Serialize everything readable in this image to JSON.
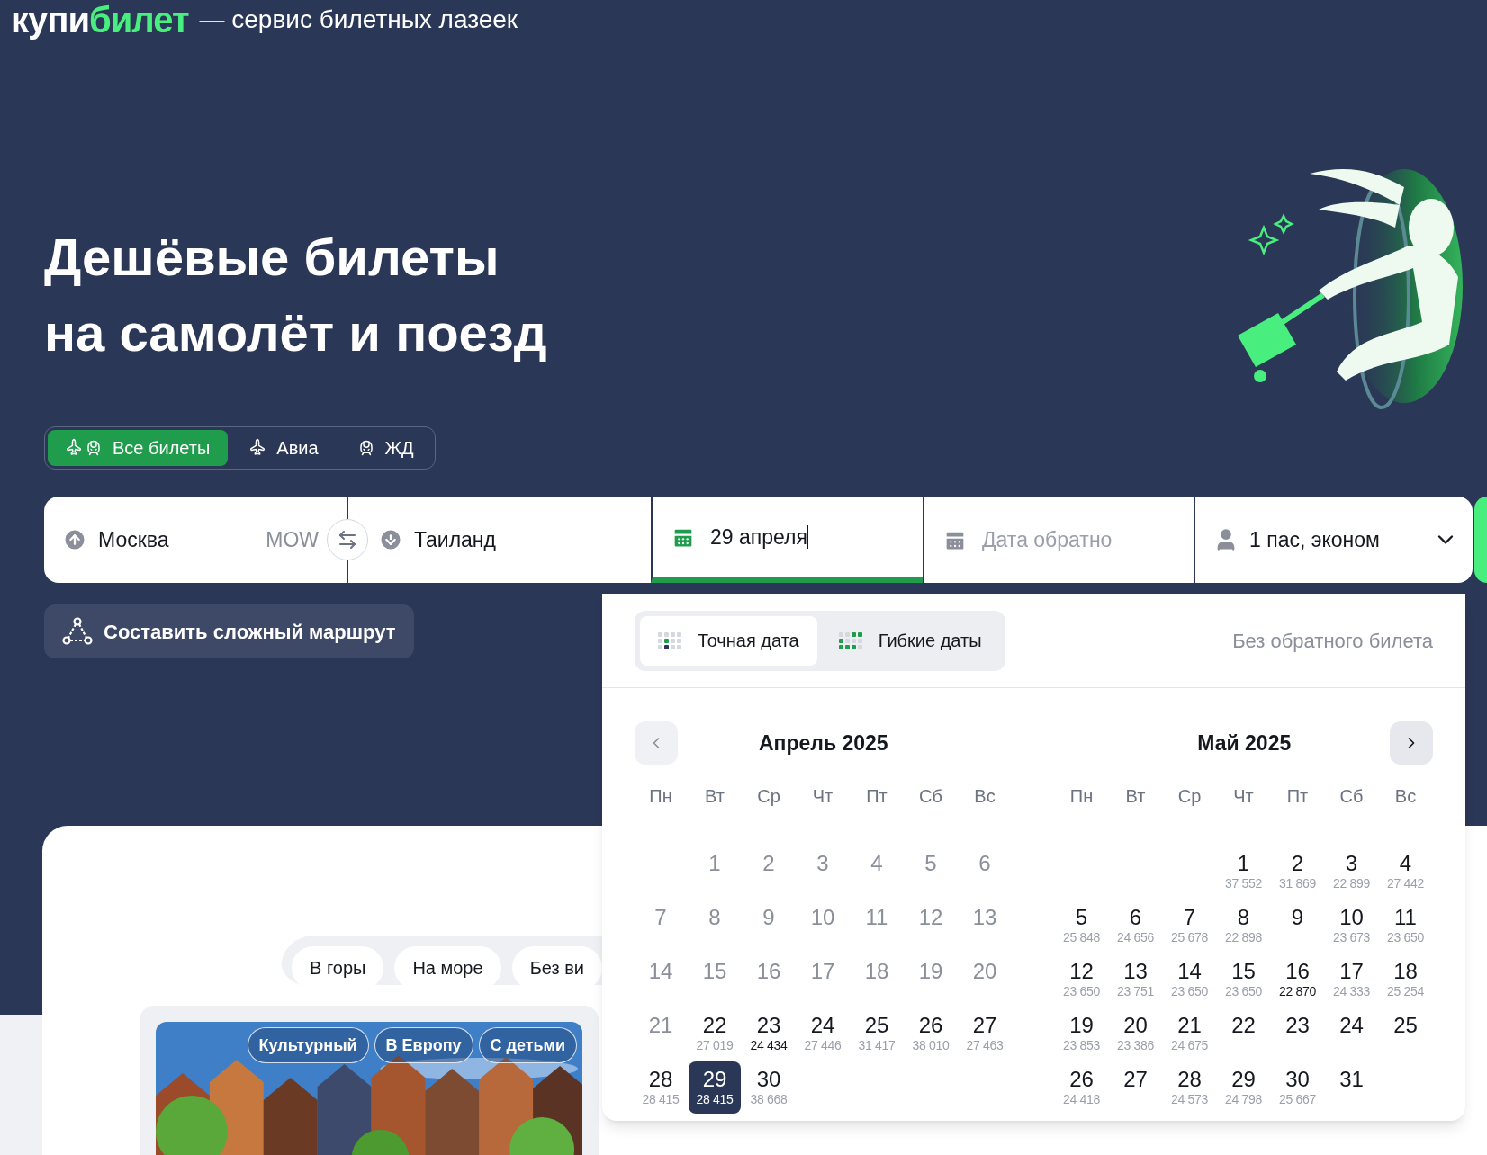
{
  "logo": {
    "first": "купи",
    "second": "билет"
  },
  "tagline": "— сервис билетных лазеек",
  "headline": [
    "Дешёвые билеты",
    "на самолёт и поезд"
  ],
  "transport_tabs": [
    {
      "label": "Все билеты",
      "selected": true
    },
    {
      "label": "Авиа",
      "selected": false
    },
    {
      "label": "ЖД",
      "selected": false
    }
  ],
  "search": {
    "from": {
      "value": "Москва",
      "code": "MOW"
    },
    "to": {
      "value": "Таиланд"
    },
    "depart": {
      "value": "29 апреля",
      "focused": true
    },
    "return": {
      "placeholder": "Дата обратно"
    },
    "passengers": {
      "value": "1 пас, эконом"
    }
  },
  "route_button": "Составить сложный маршрут",
  "date_picker": {
    "modes": [
      {
        "label": "Точная дата",
        "selected": true
      },
      {
        "label": "Гибкие даты",
        "selected": false
      }
    ],
    "no_return": "Без обратного билета",
    "months": [
      {
        "title": "Апрель 2025",
        "weekdays": [
          "Пн",
          "Вт",
          "Ср",
          "Чт",
          "Пт",
          "Сб",
          "Вс"
        ],
        "days": [
          {
            "kind": "blank"
          },
          {
            "kind": "day",
            "day": "1",
            "available": false,
            "selected": false
          },
          {
            "kind": "day",
            "day": "2",
            "available": false,
            "selected": false
          },
          {
            "kind": "day",
            "day": "3",
            "available": false,
            "selected": false
          },
          {
            "kind": "day",
            "day": "4",
            "available": false,
            "selected": false
          },
          {
            "kind": "day",
            "day": "5",
            "available": false,
            "selected": false
          },
          {
            "kind": "day",
            "day": "6",
            "available": false,
            "selected": false
          },
          {
            "kind": "day",
            "day": "7",
            "available": false,
            "selected": false
          },
          {
            "kind": "day",
            "day": "8",
            "available": false,
            "selected": false
          },
          {
            "kind": "day",
            "day": "9",
            "available": false,
            "selected": false
          },
          {
            "kind": "day",
            "day": "10",
            "available": false,
            "selected": false
          },
          {
            "kind": "day",
            "day": "11",
            "available": false,
            "selected": false
          },
          {
            "kind": "day",
            "day": "12",
            "available": false,
            "selected": false
          },
          {
            "kind": "day",
            "day": "13",
            "available": false,
            "selected": false
          },
          {
            "kind": "day",
            "day": "14",
            "available": false,
            "selected": false
          },
          {
            "kind": "day",
            "day": "15",
            "available": false,
            "selected": false
          },
          {
            "kind": "day",
            "day": "16",
            "available": false,
            "selected": false
          },
          {
            "kind": "day",
            "day": "17",
            "available": false,
            "selected": false
          },
          {
            "kind": "day",
            "day": "18",
            "available": false,
            "selected": false
          },
          {
            "kind": "day",
            "day": "19",
            "available": false,
            "selected": false
          },
          {
            "kind": "day",
            "day": "20",
            "available": false,
            "selected": false
          },
          {
            "kind": "day",
            "day": "21",
            "available": false,
            "selected": false
          },
          {
            "kind": "day",
            "day": "22",
            "available": true,
            "selected": false,
            "price": "27 019",
            "best": false
          },
          {
            "kind": "day",
            "day": "23",
            "available": true,
            "selected": false,
            "price": "24 434",
            "best": true
          },
          {
            "kind": "day",
            "day": "24",
            "available": true,
            "selected": false,
            "price": "27 446",
            "best": false
          },
          {
            "kind": "day",
            "day": "25",
            "available": true,
            "selected": false,
            "price": "31 417",
            "best": false
          },
          {
            "kind": "day",
            "day": "26",
            "available": true,
            "selected": false,
            "price": "38 010",
            "best": false
          },
          {
            "kind": "day",
            "day": "27",
            "available": true,
            "selected": false,
            "price": "27 463",
            "best": false
          },
          {
            "kind": "day",
            "day": "28",
            "available": true,
            "selected": false,
            "price": "28 415",
            "best": false
          },
          {
            "kind": "day",
            "day": "29",
            "available": true,
            "selected": true,
            "price": "28 415",
            "best": false
          },
          {
            "kind": "day",
            "day": "30",
            "available": true,
            "selected": false,
            "price": "38 668",
            "best": false
          }
        ]
      },
      {
        "title": "Май 2025",
        "weekdays": [
          "Пн",
          "Вт",
          "Ср",
          "Чт",
          "Пт",
          "Сб",
          "Вс"
        ],
        "days": [
          {
            "kind": "blank"
          },
          {
            "kind": "blank"
          },
          {
            "kind": "blank"
          },
          {
            "kind": "day",
            "day": "1",
            "available": true,
            "selected": false,
            "price": "37 552",
            "best": false
          },
          {
            "kind": "day",
            "day": "2",
            "available": true,
            "selected": false,
            "price": "31 869",
            "best": false
          },
          {
            "kind": "day",
            "day": "3",
            "available": true,
            "selected": false,
            "price": "22 899",
            "best": false
          },
          {
            "kind": "day",
            "day": "4",
            "available": true,
            "selected": false,
            "price": "27 442",
            "best": false
          },
          {
            "kind": "day",
            "day": "5",
            "available": true,
            "selected": false,
            "price": "25 848",
            "best": false
          },
          {
            "kind": "day",
            "day": "6",
            "available": true,
            "selected": false,
            "price": "24 656",
            "best": false
          },
          {
            "kind": "day",
            "day": "7",
            "available": true,
            "selected": false,
            "price": "25 678",
            "best": false
          },
          {
            "kind": "day",
            "day": "8",
            "available": true,
            "selected": false,
            "price": "22 898",
            "best": false
          },
          {
            "kind": "day",
            "day": "9",
            "available": true,
            "selected": false
          },
          {
            "kind": "day",
            "day": "10",
            "available": true,
            "selected": false,
            "price": "23 673",
            "best": false
          },
          {
            "kind": "day",
            "day": "11",
            "available": true,
            "selected": false,
            "price": "23 650",
            "best": false
          },
          {
            "kind": "day",
            "day": "12",
            "available": true,
            "selected": false,
            "price": "23 650",
            "best": false
          },
          {
            "kind": "day",
            "day": "13",
            "available": true,
            "selected": false,
            "price": "23 751",
            "best": false
          },
          {
            "kind": "day",
            "day": "14",
            "available": true,
            "selected": false,
            "price": "23 650",
            "best": false
          },
          {
            "kind": "day",
            "day": "15",
            "available": true,
            "selected": false,
            "price": "23 650",
            "best": false
          },
          {
            "kind": "day",
            "day": "16",
            "available": true,
            "selected": false,
            "price": "22 870",
            "best": true
          },
          {
            "kind": "day",
            "day": "17",
            "available": true,
            "selected": false,
            "price": "24 333",
            "best": false
          },
          {
            "kind": "day",
            "day": "18",
            "available": true,
            "selected": false,
            "price": "25 254",
            "best": false
          },
          {
            "kind": "day",
            "day": "19",
            "available": true,
            "selected": false,
            "price": "23 853",
            "best": false
          },
          {
            "kind": "day",
            "day": "20",
            "available": true,
            "selected": false,
            "price": "23 386",
            "best": false
          },
          {
            "kind": "day",
            "day": "21",
            "available": true,
            "selected": false,
            "price": "24 675",
            "best": false
          },
          {
            "kind": "day",
            "day": "22",
            "available": true,
            "selected": false
          },
          {
            "kind": "day",
            "day": "23",
            "available": true,
            "selected": false
          },
          {
            "kind": "day",
            "day": "24",
            "available": true,
            "selected": false
          },
          {
            "kind": "day",
            "day": "25",
            "available": true,
            "selected": false
          },
          {
            "kind": "day",
            "day": "26",
            "available": true,
            "selected": false,
            "price": "24 418",
            "best": false
          },
          {
            "kind": "day",
            "day": "27",
            "available": true,
            "selected": false
          },
          {
            "kind": "day",
            "day": "28",
            "available": true,
            "selected": false,
            "price": "24 573",
            "best": false
          },
          {
            "kind": "day",
            "day": "29",
            "available": true,
            "selected": false,
            "price": "24 798",
            "best": false
          },
          {
            "kind": "day",
            "day": "30",
            "available": true,
            "selected": false,
            "price": "25 667",
            "best": false
          },
          {
            "kind": "day",
            "day": "31",
            "available": true,
            "selected": false
          }
        ]
      }
    ]
  },
  "chips": [
    "В горы",
    "На море",
    "Без ви"
  ],
  "card": {
    "tags": [
      "Культурный",
      "В Европу",
      "С детьми"
    ]
  }
}
